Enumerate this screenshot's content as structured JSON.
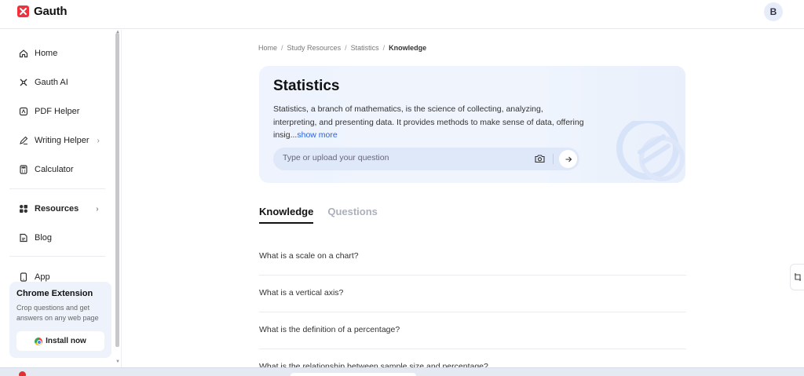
{
  "app": {
    "name": "Gauth",
    "avatar_initial": "B",
    "brand_color": "#f0323c",
    "accent_color": "#2b63d9"
  },
  "sidebar": {
    "items": [
      {
        "label": "Home",
        "icon": "home-icon"
      },
      {
        "label": "Gauth AI",
        "icon": "gauth-ai-icon"
      },
      {
        "label": "PDF Helper",
        "icon": "pdf-icon"
      },
      {
        "label": "Writing Helper",
        "icon": "pen-icon",
        "has_chevron": true
      },
      {
        "label": "Calculator",
        "icon": "calculator-icon"
      },
      {
        "label": "Resources",
        "icon": "grid-icon",
        "has_chevron": true
      },
      {
        "label": "Blog",
        "icon": "blog-icon"
      },
      {
        "label": "App",
        "icon": "phone-icon"
      }
    ],
    "chrome_card": {
      "title": "Chrome Extension",
      "description": "Crop questions and get answers on any web page",
      "button_label": "Install now"
    }
  },
  "breadcrumb": {
    "items": [
      "Home",
      "Study Resources",
      "Statistics"
    ],
    "current": "Knowledge",
    "separator": "/"
  },
  "hero": {
    "title": "Statistics",
    "description": "Statistics, a branch of mathematics, is the science of collecting, analyzing, interpreting, and presenting data. It provides methods to make sense of data, offering insig...",
    "show_more": "show more",
    "search_placeholder": "Type or upload your question"
  },
  "tabs": [
    {
      "label": "Knowledge",
      "active": true
    },
    {
      "label": "Questions",
      "active": false
    }
  ],
  "questions": [
    "What is a scale on a chart?",
    "What is a vertical axis?",
    "What is the definition of a percentage?",
    "What is the relationship between sample size and percentage?"
  ]
}
